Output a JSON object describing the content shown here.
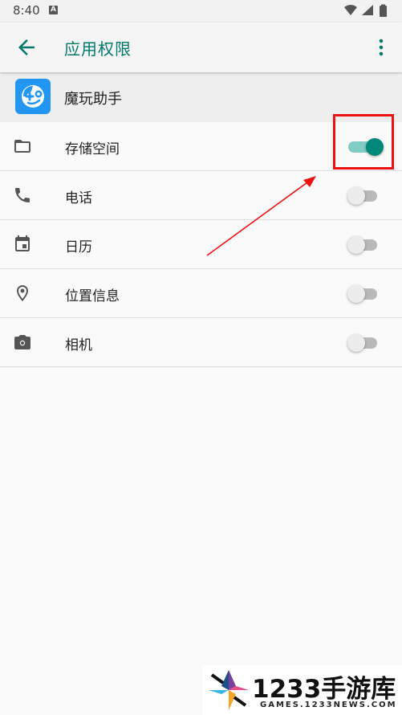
{
  "status_bar": {
    "time": "8:40",
    "notification_icon": "A"
  },
  "app_bar": {
    "title": "应用权限",
    "back_icon": "arrow-left-icon",
    "menu_icon": "more-vert-icon"
  },
  "app": {
    "name": "魔玩助手",
    "icon": "app-logo-icon"
  },
  "permissions": [
    {
      "label": "存储空间",
      "icon": "folder-icon",
      "enabled": true
    },
    {
      "label": "电话",
      "icon": "phone-icon",
      "enabled": false
    },
    {
      "label": "日历",
      "icon": "calendar-icon",
      "enabled": false
    },
    {
      "label": "位置信息",
      "icon": "location-icon",
      "enabled": false
    },
    {
      "label": "相机",
      "icon": "camera-icon",
      "enabled": false
    }
  ],
  "colors": {
    "accent": "#00796b",
    "switch_on_thumb": "#00897b",
    "switch_on_track": "#80cbc4",
    "highlight": "#ee1111"
  },
  "watermark": {
    "brand": "1233手游库",
    "url": "GAMES.1233NEWS.COM"
  }
}
